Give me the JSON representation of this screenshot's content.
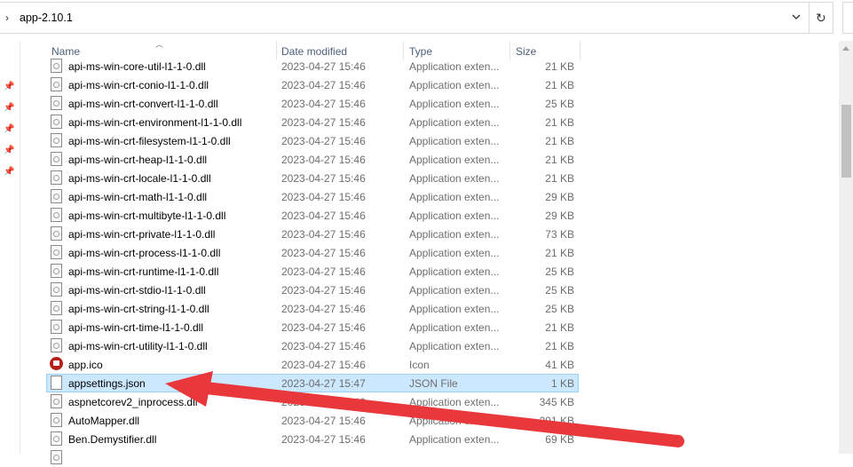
{
  "address": {
    "path": "app-2.10.1"
  },
  "icons": {
    "chevron": "chevron-right-icon",
    "dropdown": "chevron-down-icon",
    "refresh": "refresh-icon",
    "pin": "pin-icon"
  },
  "columns": {
    "name": "Name",
    "date": "Date modified",
    "type": "Type",
    "size": "Size"
  },
  "files": [
    {
      "name": "api-ms-win-core-util-l1-1-0.dll",
      "date": "2023-04-27 15:46",
      "type": "Application exten...",
      "size": "21 KB",
      "icon": "dll"
    },
    {
      "name": "api-ms-win-crt-conio-l1-1-0.dll",
      "date": "2023-04-27 15:46",
      "type": "Application exten...",
      "size": "21 KB",
      "icon": "dll"
    },
    {
      "name": "api-ms-win-crt-convert-l1-1-0.dll",
      "date": "2023-04-27 15:46",
      "type": "Application exten...",
      "size": "25 KB",
      "icon": "dll"
    },
    {
      "name": "api-ms-win-crt-environment-l1-1-0.dll",
      "date": "2023-04-27 15:46",
      "type": "Application exten...",
      "size": "21 KB",
      "icon": "dll"
    },
    {
      "name": "api-ms-win-crt-filesystem-l1-1-0.dll",
      "date": "2023-04-27 15:46",
      "type": "Application exten...",
      "size": "21 KB",
      "icon": "dll"
    },
    {
      "name": "api-ms-win-crt-heap-l1-1-0.dll",
      "date": "2023-04-27 15:46",
      "type": "Application exten...",
      "size": "21 KB",
      "icon": "dll"
    },
    {
      "name": "api-ms-win-crt-locale-l1-1-0.dll",
      "date": "2023-04-27 15:46",
      "type": "Application exten...",
      "size": "21 KB",
      "icon": "dll"
    },
    {
      "name": "api-ms-win-crt-math-l1-1-0.dll",
      "date": "2023-04-27 15:46",
      "type": "Application exten...",
      "size": "29 KB",
      "icon": "dll"
    },
    {
      "name": "api-ms-win-crt-multibyte-l1-1-0.dll",
      "date": "2023-04-27 15:46",
      "type": "Application exten...",
      "size": "29 KB",
      "icon": "dll"
    },
    {
      "name": "api-ms-win-crt-private-l1-1-0.dll",
      "date": "2023-04-27 15:46",
      "type": "Application exten...",
      "size": "73 KB",
      "icon": "dll"
    },
    {
      "name": "api-ms-win-crt-process-l1-1-0.dll",
      "date": "2023-04-27 15:46",
      "type": "Application exten...",
      "size": "21 KB",
      "icon": "dll"
    },
    {
      "name": "api-ms-win-crt-runtime-l1-1-0.dll",
      "date": "2023-04-27 15:46",
      "type": "Application exten...",
      "size": "25 KB",
      "icon": "dll"
    },
    {
      "name": "api-ms-win-crt-stdio-l1-1-0.dll",
      "date": "2023-04-27 15:46",
      "type": "Application exten...",
      "size": "25 KB",
      "icon": "dll"
    },
    {
      "name": "api-ms-win-crt-string-l1-1-0.dll",
      "date": "2023-04-27 15:46",
      "type": "Application exten...",
      "size": "25 KB",
      "icon": "dll"
    },
    {
      "name": "api-ms-win-crt-time-l1-1-0.dll",
      "date": "2023-04-27 15:46",
      "type": "Application exten...",
      "size": "21 KB",
      "icon": "dll"
    },
    {
      "name": "api-ms-win-crt-utility-l1-1-0.dll",
      "date": "2023-04-27 15:46",
      "type": "Application exten...",
      "size": "21 KB",
      "icon": "dll"
    },
    {
      "name": "app.ico",
      "date": "2023-04-27 15:46",
      "type": "Icon",
      "size": "41 KB",
      "icon": "ico"
    },
    {
      "name": "appsettings.json",
      "date": "2023-04-27 15:47",
      "type": "JSON File",
      "size": "1 KB",
      "icon": "blank",
      "selected": true
    },
    {
      "name": "aspnetcorev2_inprocess.dll",
      "date": "2023-04-27 15:46",
      "type": "Application exten...",
      "size": "345 KB",
      "icon": "dll"
    },
    {
      "name": "AutoMapper.dll",
      "date": "2023-04-27 15:46",
      "type": "Application exten...",
      "size": "291 KB",
      "icon": "dll"
    },
    {
      "name": "Ben.Demystifier.dll",
      "date": "2023-04-27 15:46",
      "type": "Application exten...",
      "size": "69 KB",
      "icon": "dll"
    },
    {
      "name": "",
      "date": "",
      "type": "",
      "size": "",
      "icon": "dll"
    }
  ],
  "annotation": {
    "color": "#e8383b"
  }
}
